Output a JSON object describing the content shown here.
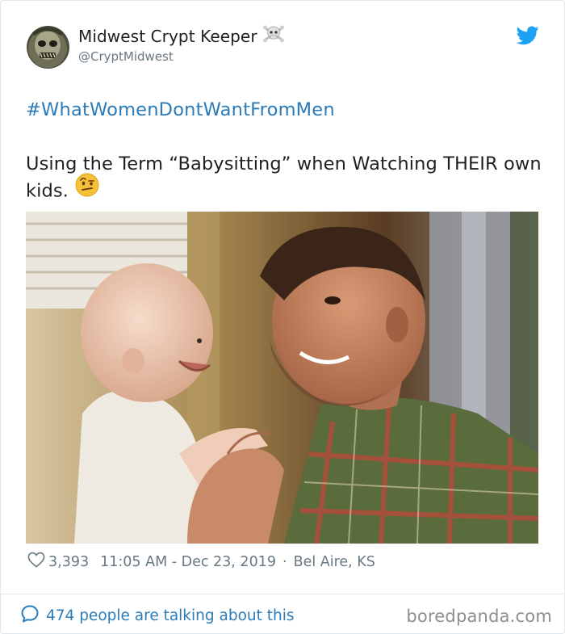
{
  "tweet": {
    "display_name": "Midwest Crypt Keeper",
    "name_emoji_icon": "skull-crossbones-icon",
    "handle": "@CryptMidwest",
    "platform_icon": "twitter-bird-icon",
    "hashtag": "#WhatWomenDontWantFromMen",
    "text": "Using the Term “Babysitting” when Watching THEIR own kids.",
    "text_emoji_icon": "raised-eyebrow-face-icon",
    "likes": "3,393",
    "timestamp": "11:05 AM - Dec 23, 2019",
    "separator": "·",
    "location": "Bel Aire, KS",
    "talking": "474 people are talking about this"
  },
  "watermark": "boredpanda.com",
  "colors": {
    "link": "#2b7bb9",
    "muted": "#697882",
    "text": "#1c2022",
    "border": "#e1e8ed"
  }
}
